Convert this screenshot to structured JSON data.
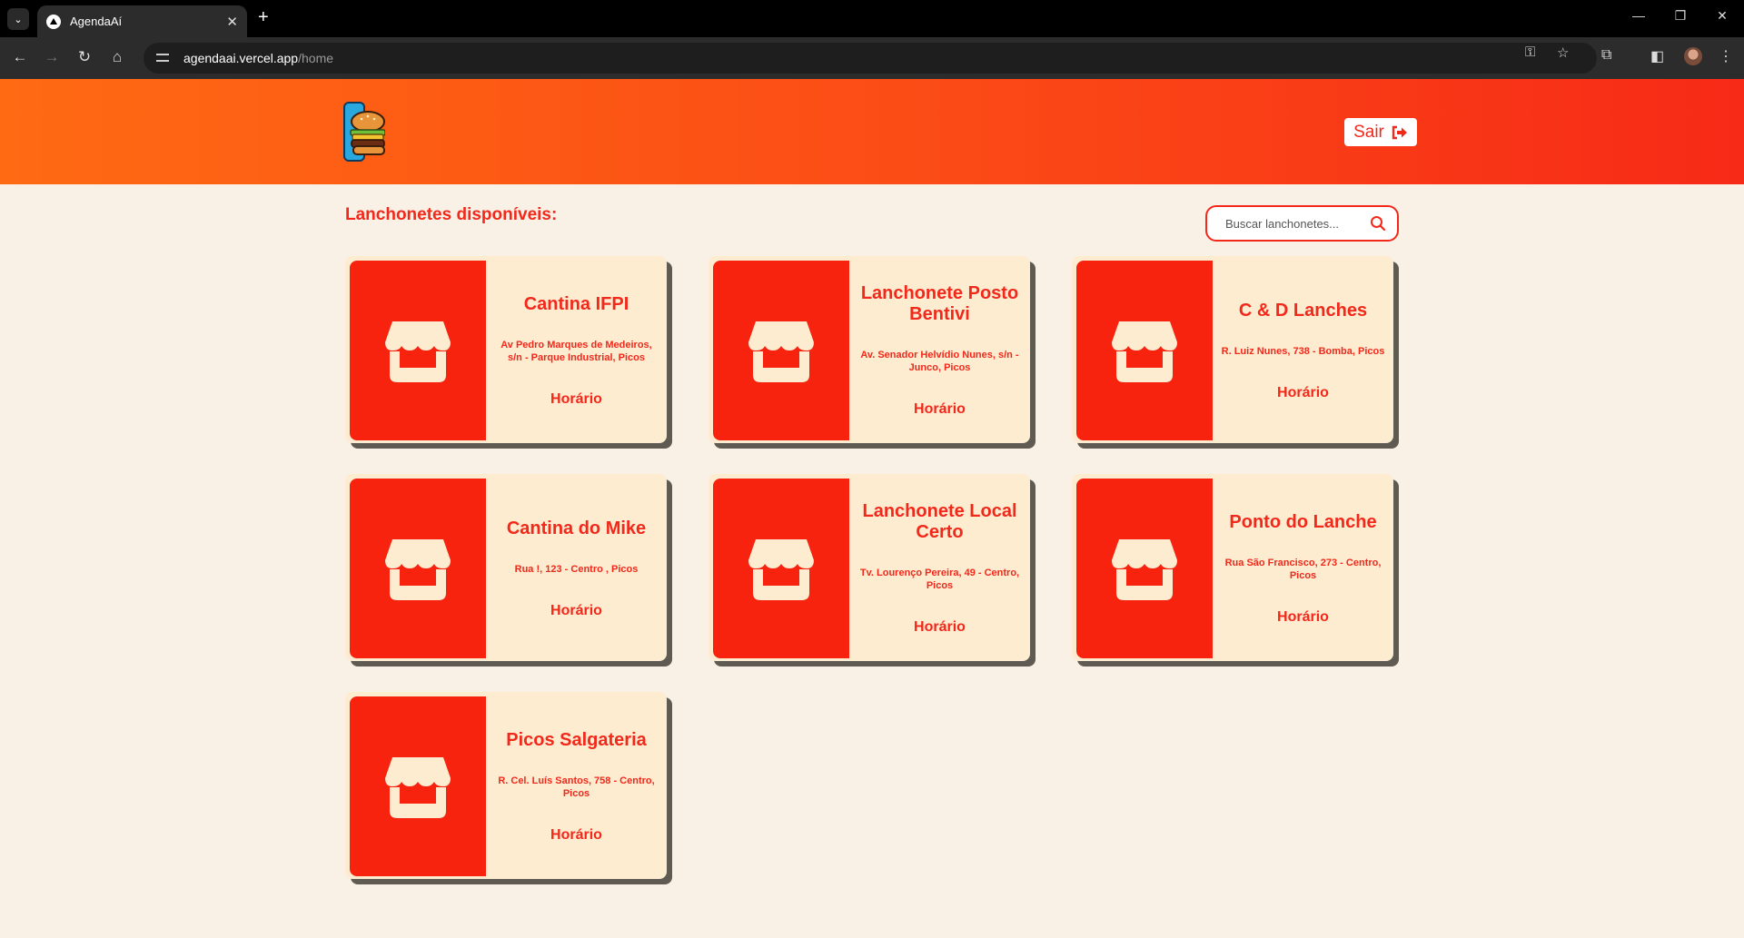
{
  "browser": {
    "tab_title": "AgendaAí",
    "url_host": "agendaai.vercel.app",
    "url_path": "/home"
  },
  "header": {
    "logout_label": "Sair"
  },
  "main": {
    "title": "Lanchonetes disponíveis:",
    "search_placeholder": "Buscar lanchonetes...",
    "cards": [
      {
        "name": "Cantina IFPI",
        "address": "Av Pedro Marques de Medeiros, s/n - Parque Industrial, Picos",
        "hours_label": "Horário"
      },
      {
        "name": "Lanchonete Posto Bentivi",
        "address": "Av. Senador Helvídio Nunes, s/n - Junco, Picos",
        "hours_label": "Horário"
      },
      {
        "name": "C & D Lanches",
        "address": "R. Luiz Nunes, 738 - Bomba, Picos",
        "hours_label": "Horário"
      },
      {
        "name": "Cantina do Mike",
        "address": "Rua !, 123 - Centro , Picos",
        "hours_label": "Horário"
      },
      {
        "name": "Lanchonete Local Certo",
        "address": "Tv. Lourenço Pereira, 49 - Centro, Picos",
        "hours_label": "Horário"
      },
      {
        "name": "Ponto do Lanche",
        "address": "Rua São Francisco, 273 - Centro, Picos",
        "hours_label": "Horário"
      },
      {
        "name": "Picos Salgateria",
        "address": "R. Cel. Luís Santos, 758 - Centro, Picos",
        "hours_label": "Horário"
      }
    ]
  },
  "colors": {
    "accent": "#f2281b",
    "card_bg": "#fdecd0",
    "page_bg": "#faf1e6"
  },
  "icons": [
    "search-icon",
    "store-icon",
    "logout-icon",
    "burger-logo"
  ]
}
